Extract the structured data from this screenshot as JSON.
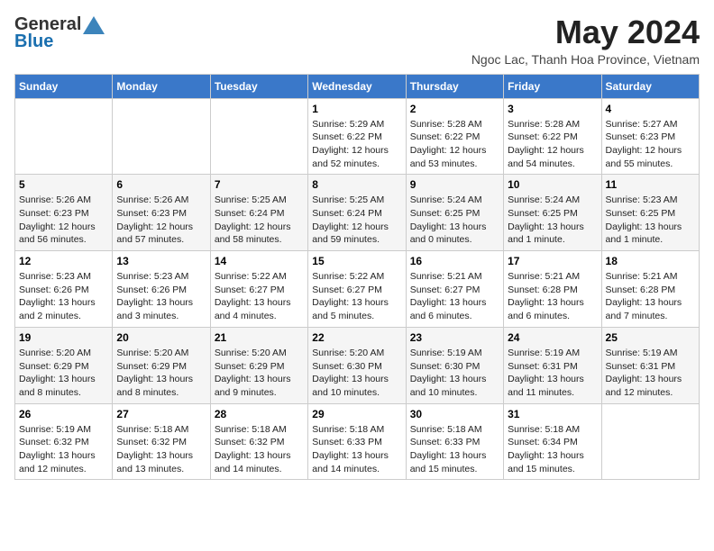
{
  "header": {
    "logo_general": "General",
    "logo_blue": "Blue",
    "title": "May 2024",
    "location": "Ngoc Lac, Thanh Hoa Province, Vietnam"
  },
  "days_of_week": [
    "Sunday",
    "Monday",
    "Tuesday",
    "Wednesday",
    "Thursday",
    "Friday",
    "Saturday"
  ],
  "weeks": [
    [
      {
        "day": "",
        "info": ""
      },
      {
        "day": "",
        "info": ""
      },
      {
        "day": "",
        "info": ""
      },
      {
        "day": "1",
        "info": "Sunrise: 5:29 AM\nSunset: 6:22 PM\nDaylight: 12 hours and 52 minutes."
      },
      {
        "day": "2",
        "info": "Sunrise: 5:28 AM\nSunset: 6:22 PM\nDaylight: 12 hours and 53 minutes."
      },
      {
        "day": "3",
        "info": "Sunrise: 5:28 AM\nSunset: 6:22 PM\nDaylight: 12 hours and 54 minutes."
      },
      {
        "day": "4",
        "info": "Sunrise: 5:27 AM\nSunset: 6:23 PM\nDaylight: 12 hours and 55 minutes."
      }
    ],
    [
      {
        "day": "5",
        "info": "Sunrise: 5:26 AM\nSunset: 6:23 PM\nDaylight: 12 hours and 56 minutes."
      },
      {
        "day": "6",
        "info": "Sunrise: 5:26 AM\nSunset: 6:23 PM\nDaylight: 12 hours and 57 minutes."
      },
      {
        "day": "7",
        "info": "Sunrise: 5:25 AM\nSunset: 6:24 PM\nDaylight: 12 hours and 58 minutes."
      },
      {
        "day": "8",
        "info": "Sunrise: 5:25 AM\nSunset: 6:24 PM\nDaylight: 12 hours and 59 minutes."
      },
      {
        "day": "9",
        "info": "Sunrise: 5:24 AM\nSunset: 6:25 PM\nDaylight: 13 hours and 0 minutes."
      },
      {
        "day": "10",
        "info": "Sunrise: 5:24 AM\nSunset: 6:25 PM\nDaylight: 13 hours and 1 minute."
      },
      {
        "day": "11",
        "info": "Sunrise: 5:23 AM\nSunset: 6:25 PM\nDaylight: 13 hours and 1 minute."
      }
    ],
    [
      {
        "day": "12",
        "info": "Sunrise: 5:23 AM\nSunset: 6:26 PM\nDaylight: 13 hours and 2 minutes."
      },
      {
        "day": "13",
        "info": "Sunrise: 5:23 AM\nSunset: 6:26 PM\nDaylight: 13 hours and 3 minutes."
      },
      {
        "day": "14",
        "info": "Sunrise: 5:22 AM\nSunset: 6:27 PM\nDaylight: 13 hours and 4 minutes."
      },
      {
        "day": "15",
        "info": "Sunrise: 5:22 AM\nSunset: 6:27 PM\nDaylight: 13 hours and 5 minutes."
      },
      {
        "day": "16",
        "info": "Sunrise: 5:21 AM\nSunset: 6:27 PM\nDaylight: 13 hours and 6 minutes."
      },
      {
        "day": "17",
        "info": "Sunrise: 5:21 AM\nSunset: 6:28 PM\nDaylight: 13 hours and 6 minutes."
      },
      {
        "day": "18",
        "info": "Sunrise: 5:21 AM\nSunset: 6:28 PM\nDaylight: 13 hours and 7 minutes."
      }
    ],
    [
      {
        "day": "19",
        "info": "Sunrise: 5:20 AM\nSunset: 6:29 PM\nDaylight: 13 hours and 8 minutes."
      },
      {
        "day": "20",
        "info": "Sunrise: 5:20 AM\nSunset: 6:29 PM\nDaylight: 13 hours and 8 minutes."
      },
      {
        "day": "21",
        "info": "Sunrise: 5:20 AM\nSunset: 6:29 PM\nDaylight: 13 hours and 9 minutes."
      },
      {
        "day": "22",
        "info": "Sunrise: 5:20 AM\nSunset: 6:30 PM\nDaylight: 13 hours and 10 minutes."
      },
      {
        "day": "23",
        "info": "Sunrise: 5:19 AM\nSunset: 6:30 PM\nDaylight: 13 hours and 10 minutes."
      },
      {
        "day": "24",
        "info": "Sunrise: 5:19 AM\nSunset: 6:31 PM\nDaylight: 13 hours and 11 minutes."
      },
      {
        "day": "25",
        "info": "Sunrise: 5:19 AM\nSunset: 6:31 PM\nDaylight: 13 hours and 12 minutes."
      }
    ],
    [
      {
        "day": "26",
        "info": "Sunrise: 5:19 AM\nSunset: 6:32 PM\nDaylight: 13 hours and 12 minutes."
      },
      {
        "day": "27",
        "info": "Sunrise: 5:18 AM\nSunset: 6:32 PM\nDaylight: 13 hours and 13 minutes."
      },
      {
        "day": "28",
        "info": "Sunrise: 5:18 AM\nSunset: 6:32 PM\nDaylight: 13 hours and 14 minutes."
      },
      {
        "day": "29",
        "info": "Sunrise: 5:18 AM\nSunset: 6:33 PM\nDaylight: 13 hours and 14 minutes."
      },
      {
        "day": "30",
        "info": "Sunrise: 5:18 AM\nSunset: 6:33 PM\nDaylight: 13 hours and 15 minutes."
      },
      {
        "day": "31",
        "info": "Sunrise: 5:18 AM\nSunset: 6:34 PM\nDaylight: 13 hours and 15 minutes."
      },
      {
        "day": "",
        "info": ""
      }
    ]
  ]
}
